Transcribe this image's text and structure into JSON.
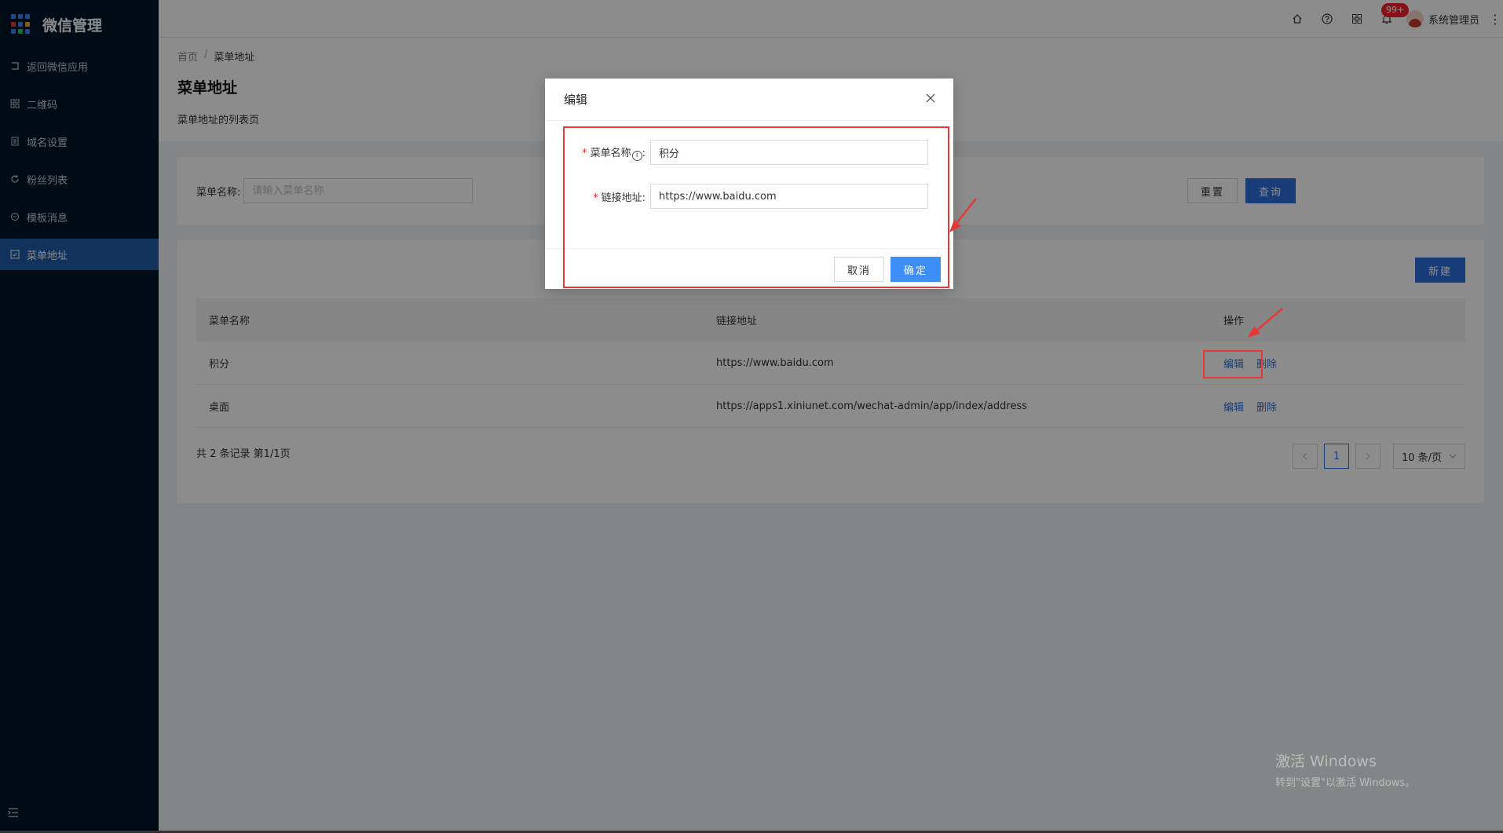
{
  "app": {
    "title": "微信管理"
  },
  "colors": {
    "sidebar_bg": "#001529",
    "accent": "#2f6fdd",
    "ok_button": "#3d8ff7",
    "annotation": "#e53935"
  },
  "sidebar": {
    "items": [
      {
        "label": "返回微信应用",
        "icon": "back-icon",
        "active": false
      },
      {
        "label": "二维码",
        "icon": "qrcode-icon",
        "active": false
      },
      {
        "label": "域名设置",
        "icon": "document-icon",
        "active": false
      },
      {
        "label": "粉丝列表",
        "icon": "refresh-icon",
        "active": false
      },
      {
        "label": "模板消息",
        "icon": "chat-icon",
        "active": false
      },
      {
        "label": "菜单地址",
        "icon": "checkbox-icon",
        "active": true
      }
    ]
  },
  "header": {
    "badge": "99+",
    "user": "系统管理员"
  },
  "breadcrumb": {
    "home": "首页",
    "sep": "/",
    "current": "菜单地址"
  },
  "page": {
    "title": "菜单地址",
    "desc": "菜单地址的列表页"
  },
  "search": {
    "label": "菜单名称:",
    "placeholder": "请输入菜单名称",
    "reset": "重置",
    "query": "查询"
  },
  "table": {
    "new_button": "新建",
    "columns": [
      "菜单名称",
      "链接地址",
      "操作"
    ],
    "rows": [
      {
        "name": "积分",
        "url": "https://www.baidu.com",
        "edit": "编辑",
        "delete": "删除"
      },
      {
        "name": "桌面",
        "url": "https://apps1.xiniunet.com/wechat-admin/app/index/address",
        "edit": "编辑",
        "delete": "删除"
      }
    ],
    "total": "共 2 条记录 第1/1页",
    "pagination": {
      "current": "1",
      "page_size": "10 条/页"
    }
  },
  "modal": {
    "title": "编辑",
    "name_label": "菜单名称",
    "name_info": "i",
    "name_colon": ":",
    "name_value": "积分",
    "url_label": "链接地址:",
    "url_value": "https://www.baidu.com",
    "cancel": "取消",
    "ok": "确定"
  },
  "watermark": {
    "line1": "激活 Windows",
    "line2": "转到\"设置\"以激活 Windows。"
  }
}
